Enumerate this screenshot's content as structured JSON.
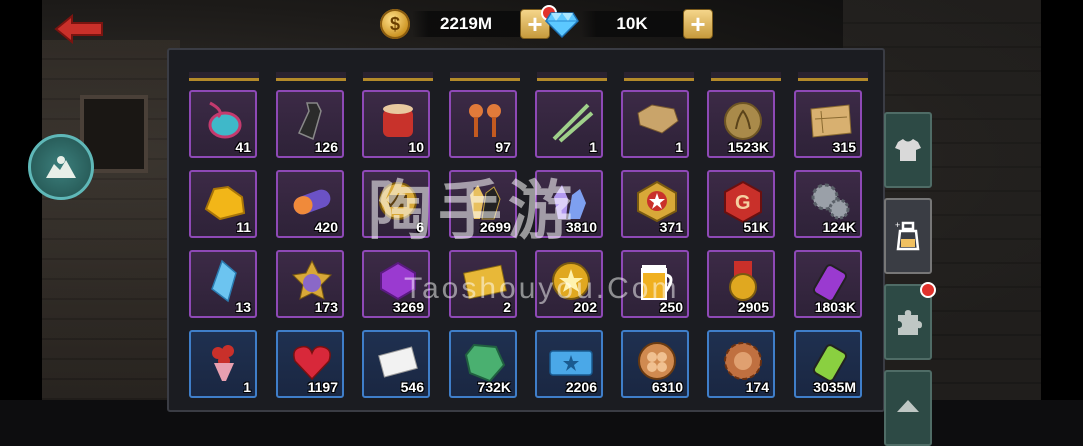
{
  "topbar": {
    "gold_amount": "2219M",
    "gem_amount": "10K",
    "gold_icon": "dollar-coin-icon",
    "gem_icon": "diamond-icon",
    "back_icon": "back-arrow-icon"
  },
  "watermark": {
    "text": "陶手游",
    "subtext": "Taoshouyou.Com"
  },
  "side_tabs": [
    {
      "icon": "shirt-icon",
      "active": false
    },
    {
      "icon": "potion-bottle-icon",
      "active": true
    },
    {
      "icon": "puzzle-piece-icon",
      "active": false,
      "badge": true
    },
    {
      "icon": "diamond-tab-icon",
      "active": false
    }
  ],
  "inventory": {
    "rows": [
      [
        {
          "icon": "amulet-icon",
          "qty": "41",
          "rarity": "purple"
        },
        {
          "icon": "necktie-icon",
          "qty": "126",
          "rarity": "purple"
        },
        {
          "icon": "drum-icon",
          "qty": "10",
          "rarity": "purple"
        },
        {
          "icon": "maracas-icon",
          "qty": "97",
          "rarity": "purple"
        },
        {
          "icon": "chopsticks-icon",
          "qty": "1",
          "rarity": "purple"
        },
        {
          "icon": "map-fragment-icon",
          "qty": "1",
          "rarity": "purple"
        },
        {
          "icon": "laurel-coin-icon",
          "qty": "1523K",
          "rarity": "purple"
        },
        {
          "icon": "treasure-map-icon",
          "qty": "315",
          "rarity": "purple"
        }
      ],
      [
        {
          "icon": "gold-ore-icon",
          "qty": "11",
          "rarity": "purple"
        },
        {
          "icon": "capsule-icon",
          "qty": "420",
          "rarity": "purple"
        },
        {
          "icon": "gold-token-icon",
          "qty": "6",
          "rarity": "purple"
        },
        {
          "icon": "crystal-icon",
          "qty": "2699",
          "rarity": "purple"
        },
        {
          "icon": "purple-crystal-icon",
          "qty": "3810",
          "rarity": "purple"
        },
        {
          "icon": "star-badge-icon",
          "qty": "371",
          "rarity": "purple"
        },
        {
          "icon": "g-badge-icon",
          "qty": "51K",
          "rarity": "purple"
        },
        {
          "icon": "gears-icon",
          "qty": "124K",
          "rarity": "purple"
        }
      ],
      [
        {
          "icon": "blue-shard-icon",
          "qty": "13",
          "rarity": "purple"
        },
        {
          "icon": "rank-star-icon",
          "qty": "173",
          "rarity": "purple"
        },
        {
          "icon": "purple-gem-icon",
          "qty": "3269",
          "rarity": "purple"
        },
        {
          "icon": "gold-envelope-icon",
          "qty": "2",
          "rarity": "purple"
        },
        {
          "icon": "gold-star-coin-icon",
          "qty": "202",
          "rarity": "purple"
        },
        {
          "icon": "beer-mug-icon",
          "qty": "250",
          "rarity": "purple"
        },
        {
          "icon": "medal-icon",
          "qty": "2905",
          "rarity": "purple"
        },
        {
          "icon": "purple-battery-icon",
          "qty": "1803K",
          "rarity": "purple"
        }
      ],
      [
        {
          "icon": "rose-bouquet-icon",
          "qty": "1",
          "rarity": "blue"
        },
        {
          "icon": "heart-icon",
          "qty": "1197",
          "rarity": "blue"
        },
        {
          "icon": "envelope-icon",
          "qty": "546",
          "rarity": "blue"
        },
        {
          "icon": "green-gem-icon",
          "qty": "732K",
          "rarity": "blue"
        },
        {
          "icon": "blue-ticket-icon",
          "qty": "2206",
          "rarity": "blue"
        },
        {
          "icon": "clover-coin-icon",
          "qty": "6310",
          "rarity": "blue"
        },
        {
          "icon": "bronze-chip-icon",
          "qty": "174",
          "rarity": "blue"
        },
        {
          "icon": "green-battery-icon",
          "qty": "3035M",
          "rarity": "blue"
        }
      ]
    ]
  }
}
